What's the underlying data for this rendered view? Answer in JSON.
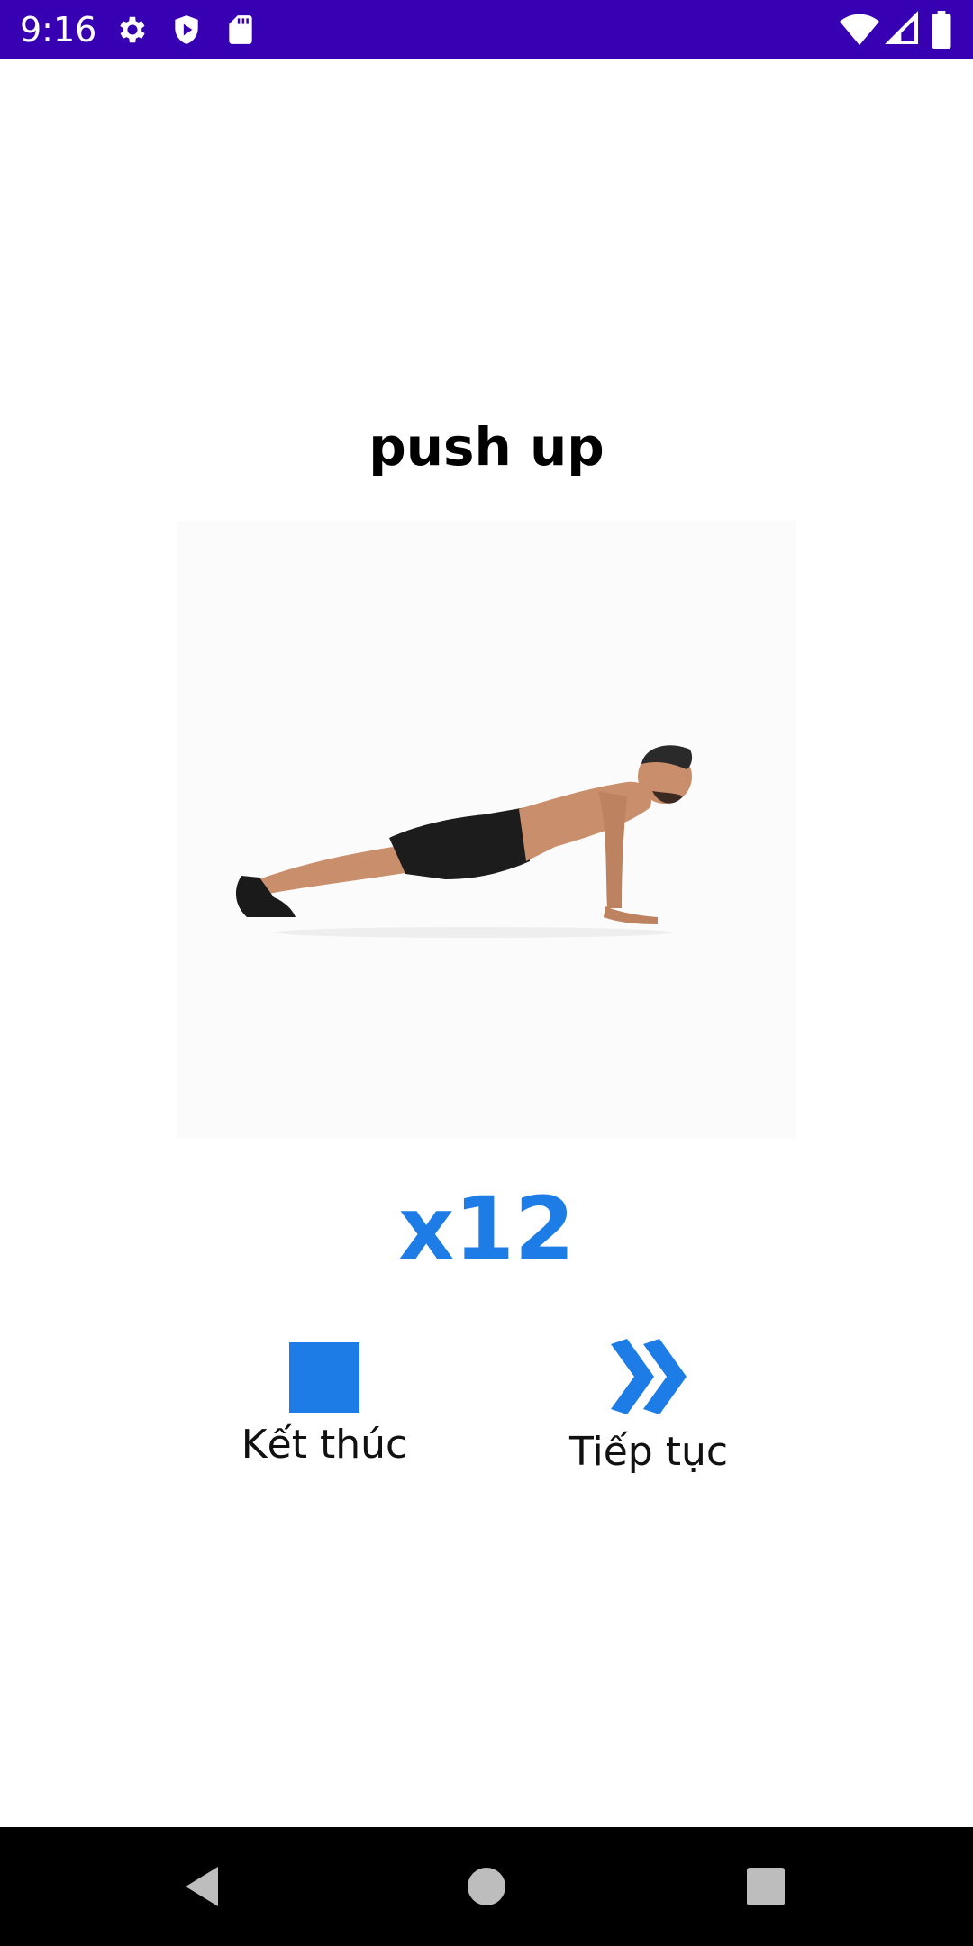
{
  "status_bar": {
    "time": "9:16",
    "background": "#3700b3",
    "left_icons": [
      "gear-icon",
      "shield-play-icon",
      "sd-card-icon"
    ],
    "right_icons": [
      "wifi-icon",
      "signal-icon",
      "battery-icon"
    ]
  },
  "exercise": {
    "title": "push up",
    "image": "push-up-figure",
    "reps": "x12"
  },
  "actions": {
    "finish_label": "Kết thúc",
    "continue_label": "Tiếp tục"
  },
  "colors": {
    "accent": "#1e7ce6",
    "nav_background": "#000000"
  },
  "nav_bar": {
    "buttons": [
      "back-icon",
      "home-icon",
      "recents-icon"
    ]
  }
}
